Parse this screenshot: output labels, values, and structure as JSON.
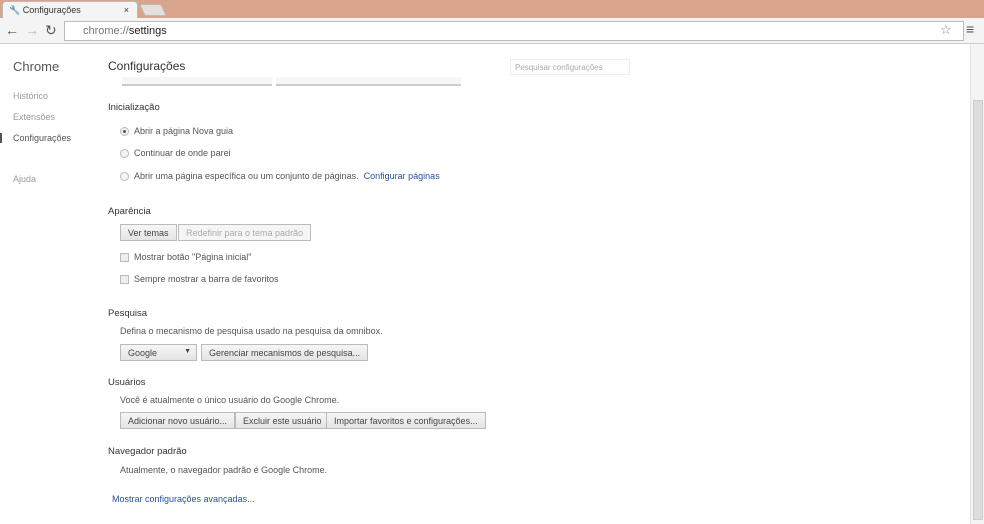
{
  "tab": {
    "title": "Configurações",
    "close": "×"
  },
  "toolbar": {
    "url_scheme": "chrome://",
    "url_path": "settings"
  },
  "sidebar": {
    "brand": "Chrome",
    "items": [
      {
        "label": "Histórico"
      },
      {
        "label": "Extensões"
      },
      {
        "label": "Configurações"
      },
      {
        "label": "Ajuda"
      }
    ]
  },
  "main": {
    "title": "Configurações",
    "search_placeholder": "Pesquisar configurações",
    "startup": {
      "heading": "Inicialização",
      "options": [
        {
          "label": "Abrir a página Nova guia",
          "selected": true
        },
        {
          "label": "Continuar de onde parei",
          "selected": false
        },
        {
          "label": "Abrir uma página específica ou um conjunto de páginas.",
          "selected": false
        }
      ],
      "set_pages_link": "Configurar páginas"
    },
    "appearance": {
      "heading": "Aparência",
      "themes_button": "Ver temas",
      "reset_theme_button": "Redefinir para o tema padrão",
      "show_home": "Mostrar botão \"Página inicial\"",
      "show_bookmarks": "Sempre mostrar a barra de favoritos"
    },
    "search": {
      "heading": "Pesquisa",
      "description": "Defina o mecanismo de pesquisa usado na pesquisa da omnibox.",
      "engine": "Google",
      "manage_button": "Gerenciar mecanismos de pesquisa..."
    },
    "users": {
      "heading": "Usuários",
      "description": "Você é atualmente o único usuário do Google Chrome.",
      "add_button": "Adicionar novo usuário...",
      "delete_button": "Excluir este usuário",
      "import_button": "Importar favoritos e configurações..."
    },
    "default_browser": {
      "heading": "Navegador padrão",
      "description": "Atualmente, o navegador padrão é Google Chrome."
    },
    "advanced_link": "Mostrar configurações avançadas..."
  }
}
